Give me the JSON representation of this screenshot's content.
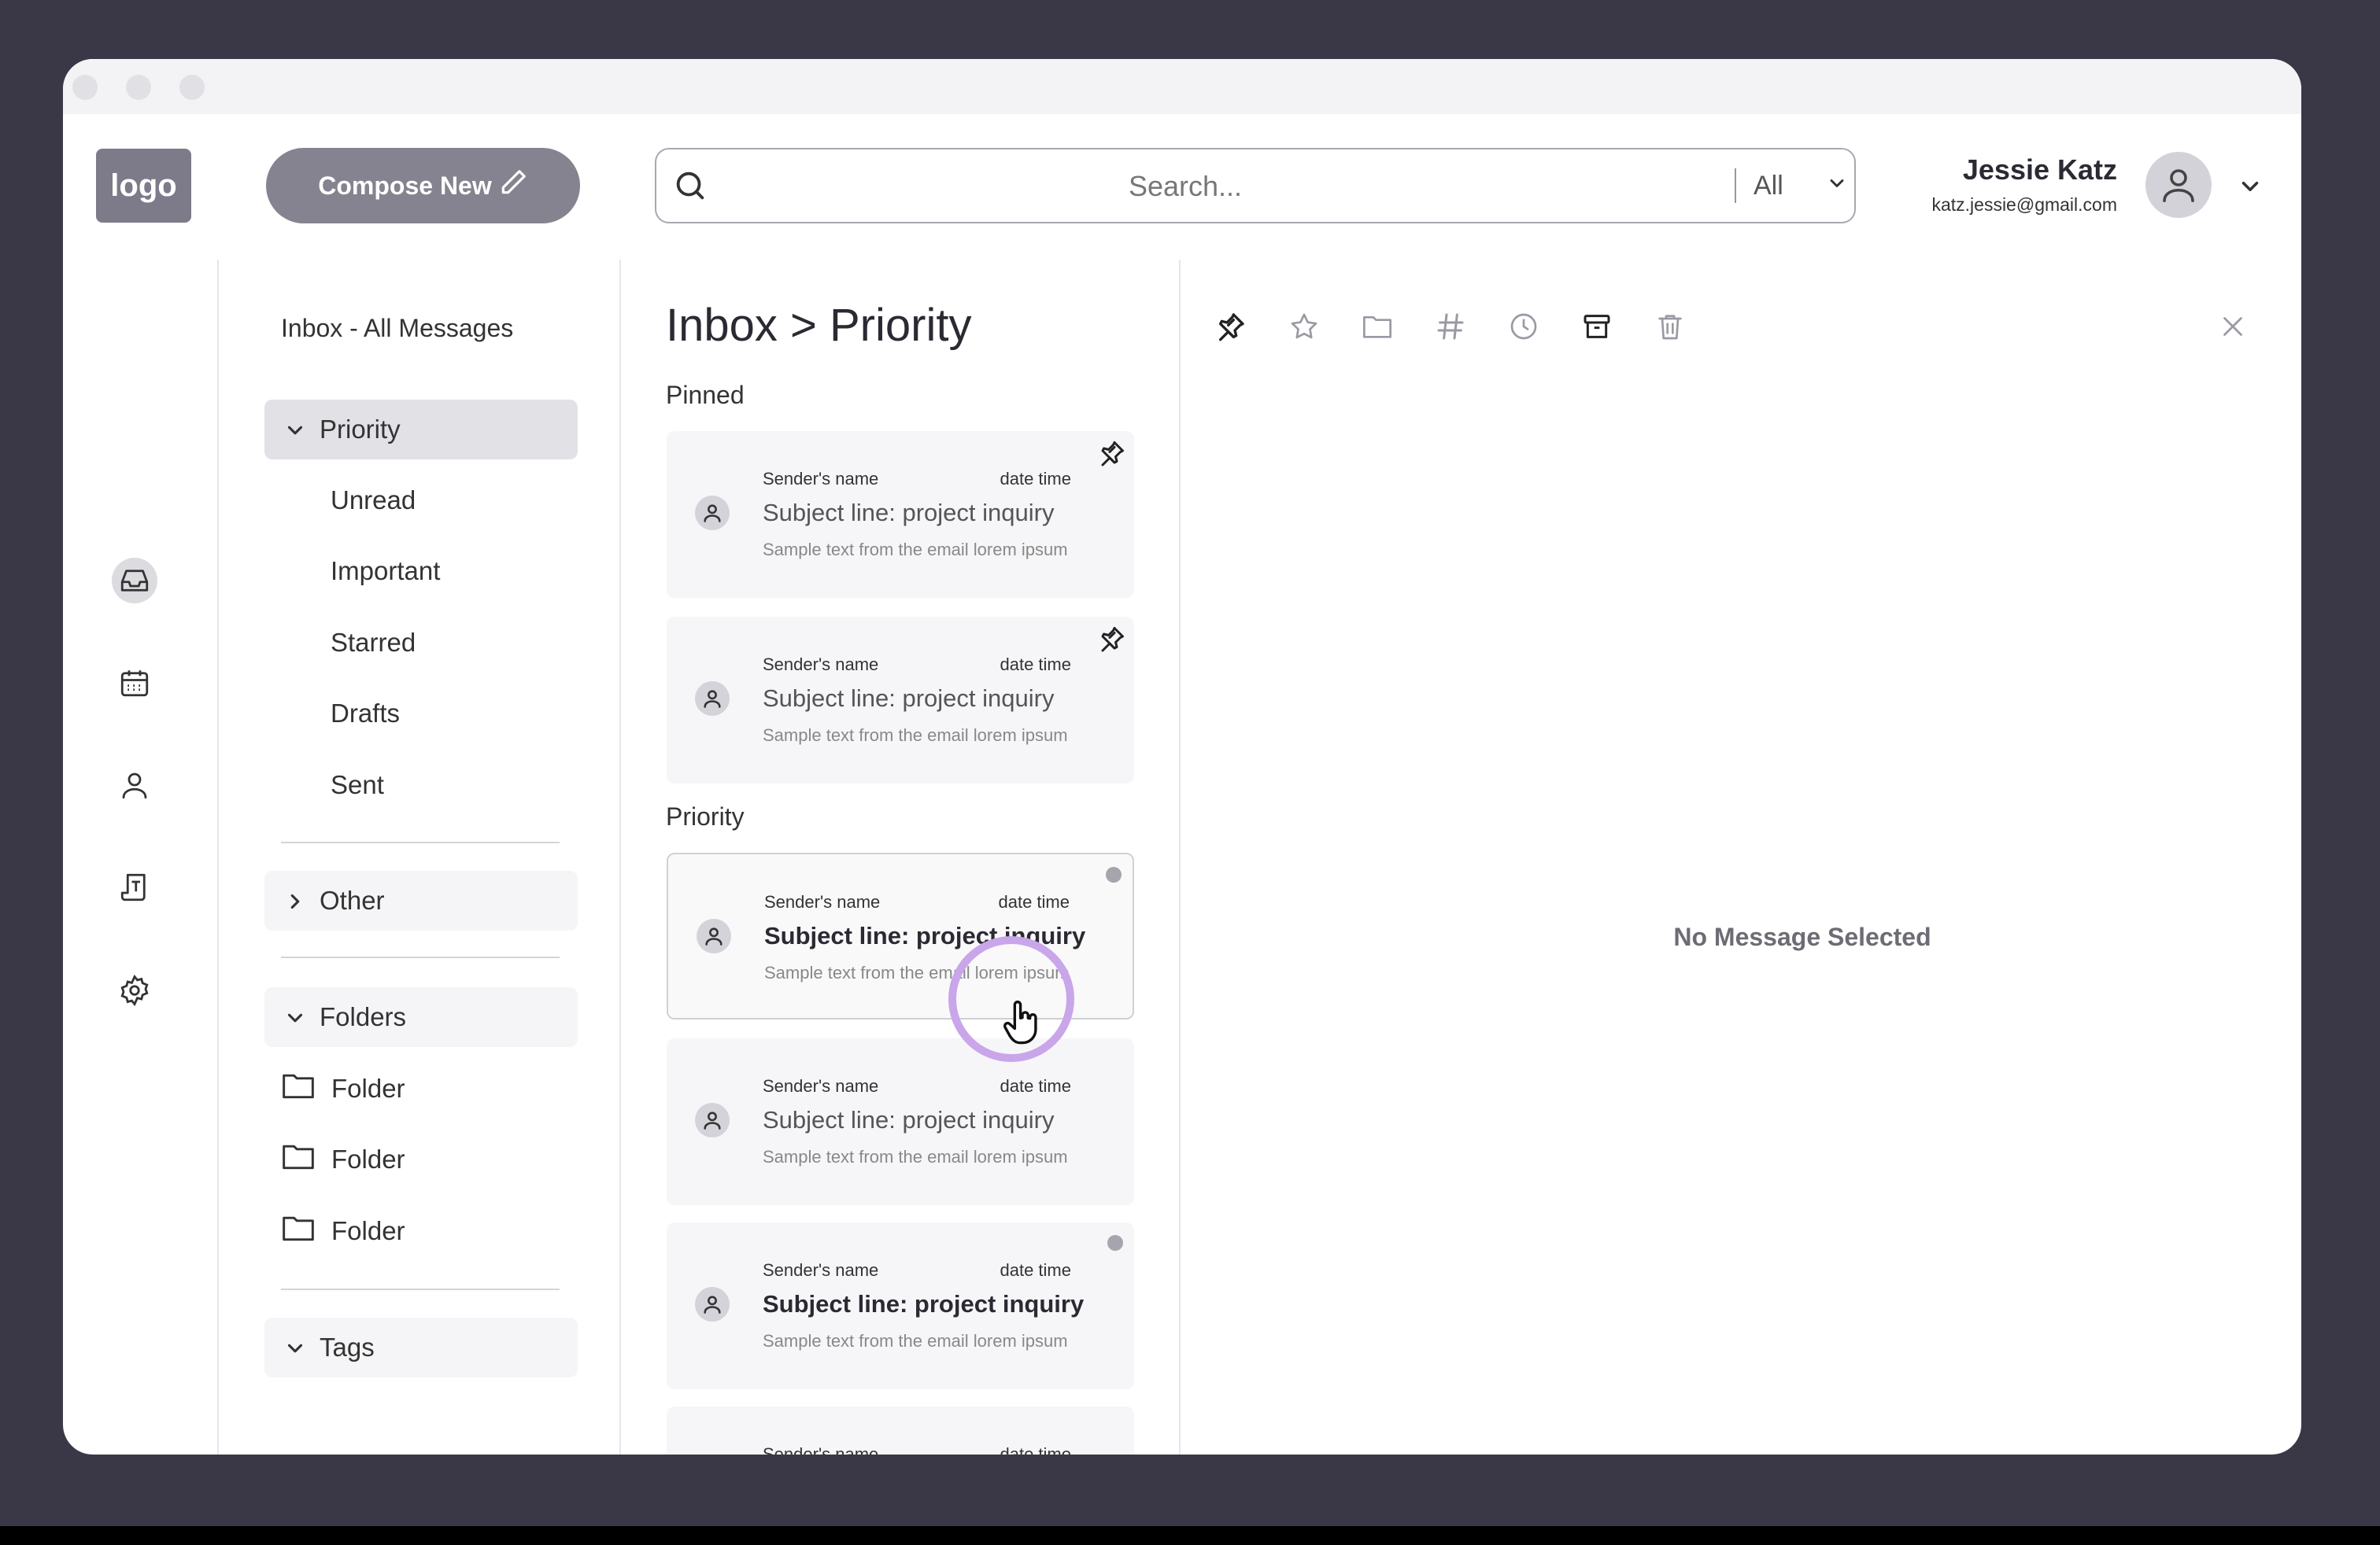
{
  "header": {
    "logo_text": "logo",
    "compose_label": "Compose New",
    "search_placeholder": "Search...",
    "search_filter": "All",
    "user_name": "Jessie Katz",
    "user_email": "katz.jessie@gmail.com"
  },
  "rail": {
    "icons": [
      "inbox-icon",
      "calendar-icon",
      "contacts-icon",
      "notes-icon",
      "settings-icon"
    ],
    "active": "inbox-icon"
  },
  "nav": {
    "all_label": "Inbox - All Messages",
    "priority_label": "Priority",
    "priority_items": [
      "Unread",
      "Important",
      "Starred",
      "Drafts",
      "Sent"
    ],
    "other_label": "Other",
    "folders_label": "Folders",
    "folder_items": [
      "Folder",
      "Folder",
      "Folder"
    ],
    "tags_label": "Tags"
  },
  "list": {
    "title": "Inbox > Priority",
    "pinned_label": "Pinned",
    "priority_label": "Priority",
    "pinned": [
      {
        "sender": "Sender's name",
        "date": "date time",
        "subject": "Subject line: project inquiry",
        "preview": "Sample text from the email lorem ipsum"
      },
      {
        "sender": "Sender's name",
        "date": "date time",
        "subject": "Subject line: project inquiry",
        "preview": "Sample text from the email lorem ipsum"
      }
    ],
    "priority": [
      {
        "sender": "Sender's name",
        "date": "date time",
        "subject": "Subject line: project inquiry",
        "preview": "Sample text from the email lorem ipsum",
        "unread": true
      },
      {
        "sender": "Sender's name",
        "date": "date time",
        "subject": "Subject line: project inquiry",
        "preview": "Sample text from the email lorem ipsum",
        "unread": false
      },
      {
        "sender": "Sender's name",
        "date": "date time",
        "subject": "Subject line: project inquiry",
        "preview": "Sample text from the email lorem ipsum",
        "unread": true
      },
      {
        "sender": "Sender's name",
        "date": "date time",
        "subject": "",
        "preview": "",
        "unread": false
      }
    ]
  },
  "detail": {
    "toolbar_icons": [
      "pin-icon",
      "star-icon",
      "folder-icon",
      "hashtag-icon",
      "clock-icon",
      "archive-icon",
      "trash-icon"
    ],
    "empty_text": "No Message Selected"
  },
  "colors": {
    "background": "#3a3846",
    "accent": "#85838f",
    "cursor_highlight": "#c9a5ea"
  }
}
